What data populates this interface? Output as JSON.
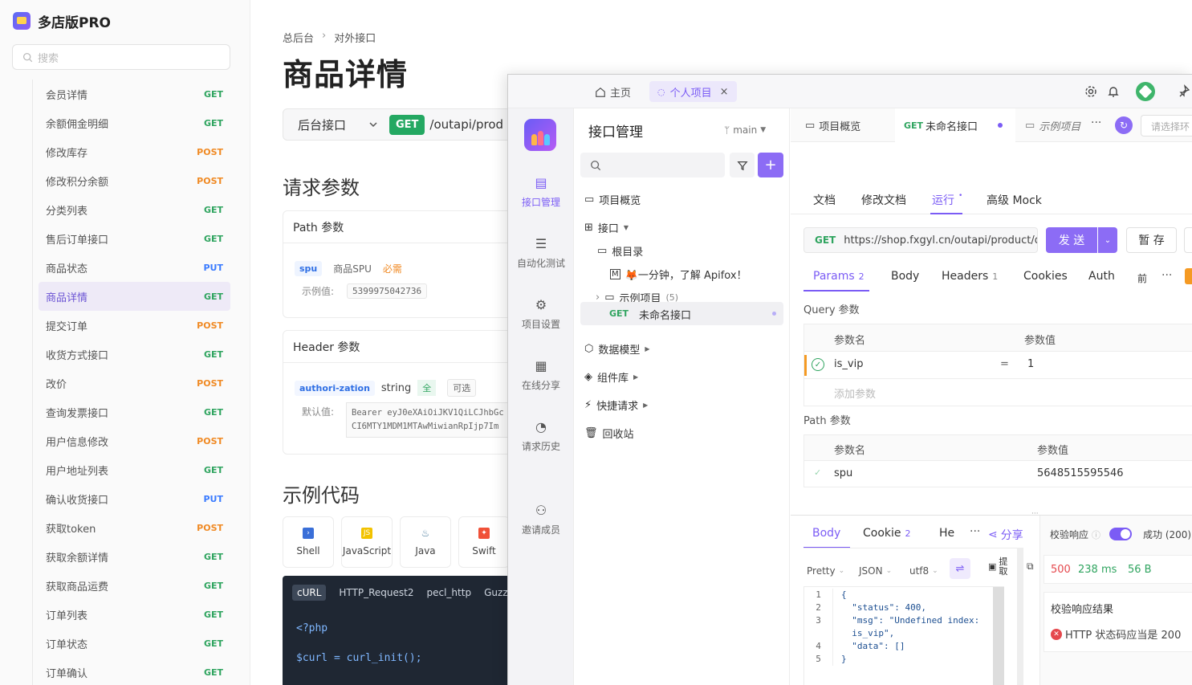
{
  "brand": {
    "name": "多店版PRO"
  },
  "doc_search": {
    "placeholder": "搜索"
  },
  "doc_list": [
    {
      "label": "会员详情",
      "method": "GET"
    },
    {
      "label": "余额佣金明细",
      "method": "GET"
    },
    {
      "label": "修改库存",
      "method": "POST"
    },
    {
      "label": "修改积分余额",
      "method": "POST"
    },
    {
      "label": "分类列表",
      "method": "GET"
    },
    {
      "label": "售后订单接口",
      "method": "GET"
    },
    {
      "label": "商品状态",
      "method": "PUT"
    },
    {
      "label": "商品详情",
      "method": "GET",
      "active": true
    },
    {
      "label": "提交订单",
      "method": "POST"
    },
    {
      "label": "收货方式接口",
      "method": "GET"
    },
    {
      "label": "改价",
      "method": "POST"
    },
    {
      "label": "查询发票接口",
      "method": "GET"
    },
    {
      "label": "用户信息修改",
      "method": "POST"
    },
    {
      "label": "用户地址列表",
      "method": "GET"
    },
    {
      "label": "确认收货接口",
      "method": "PUT"
    },
    {
      "label": "获取token",
      "method": "POST"
    },
    {
      "label": "获取余额详情",
      "method": "GET"
    },
    {
      "label": "获取商品运费",
      "method": "GET"
    },
    {
      "label": "订单列表",
      "method": "GET"
    },
    {
      "label": "订单状态",
      "method": "GET"
    },
    {
      "label": "订单确认",
      "method": "GET"
    }
  ],
  "doc": {
    "breadcrumb": [
      "总后台",
      "›",
      "对外接口"
    ],
    "title": "商品详情",
    "api_group": "后台接口",
    "method": "GET",
    "path": "/outapi/prod",
    "req_params_title": "请求参数",
    "path_params": {
      "title": "Path 参数",
      "name": "spu",
      "desc": "商品SPU",
      "required": "必需",
      "example_label": "示例值:",
      "example": "5399975042736"
    },
    "header_params": {
      "title": "Header 参数",
      "name": "authori-zation",
      "type": "string",
      "all": "全",
      "optional": "可选",
      "default_label": "默认值:",
      "default_line1": "Bearer eyJ0eXAiOiJKV1QiLCJhbGc",
      "default_line2": "CI6MTY1MDM1MTAwMiwianRpIjp7Im"
    },
    "example_title": "示例代码",
    "langs": [
      "Shell",
      "JavaScript",
      "Java",
      "Swift"
    ],
    "code_tabs": [
      "cURL",
      "HTTP_Request2",
      "pecl_http",
      "Guzzle"
    ],
    "code_lines": [
      "<?php",
      "$curl = curl_init();"
    ]
  },
  "app": {
    "tab_home": "主页",
    "tab_project": "个人项目",
    "tab_close": "×",
    "rail": [
      {
        "label": "接口管理",
        "active": true
      },
      {
        "label": "自动化测试"
      },
      {
        "label": "项目设置"
      },
      {
        "label": "在线分享"
      },
      {
        "label": "请求历史"
      },
      {
        "label": "邀请成员"
      }
    ],
    "tree": {
      "title": "接口管理",
      "branch": "main",
      "items": {
        "overview": "项目概览",
        "api": "接口",
        "root": "根目录",
        "intro": "🦊一分钟，了解 Apifox！",
        "examples": "示例项目",
        "examples_count": "(5)",
        "current_method": "GET",
        "current": "未命名接口",
        "models": "数据模型",
        "components": "组件库",
        "quick": "快捷请求",
        "trash": "回收站"
      }
    },
    "top_tabs": {
      "overview": "项目概览",
      "active_method": "GET",
      "active": "未命名接口",
      "examples": "示例项目",
      "more": "···",
      "env": "请选择环"
    },
    "sub_tabs": [
      "文档",
      "修改文档",
      "运行",
      "高级 Mock"
    ],
    "request": {
      "method": "GET",
      "url": "https://shop.fxgyl.cn/outapi/product/de",
      "send": "发 送",
      "save": "暂 存"
    },
    "param_tabs": {
      "params": "Params",
      "params_count": "2",
      "body": "Body",
      "headers": "Headers",
      "headers_count": "1",
      "cookies": "Cookies",
      "auth": "Auth",
      "pre": "前",
      "more": "···"
    },
    "query": {
      "title": "Query 参数",
      "col_name": "参数名",
      "col_value": "参数值",
      "row_name": "is_vip",
      "eq": "=",
      "row_value": "1",
      "add": "添加参数"
    },
    "path": {
      "title": "Path 参数",
      "col_name": "参数名",
      "col_value": "参数值",
      "row_name": "spu",
      "row_value": "5648515595546"
    },
    "resp_tabs": {
      "body": "Body",
      "cookie": "Cookie",
      "cookie_count": "2",
      "headers": "He",
      "more": "···",
      "share": "分享"
    },
    "resp_opts": {
      "pretty": "Pretty",
      "json": "JSON",
      "enc": "utf8",
      "extract": "提取"
    },
    "resp_lines": [
      {
        "n": "1",
        "t": "{"
      },
      {
        "n": "2",
        "t": "  \"status\": 400,"
      },
      {
        "n": "3",
        "t": "  \"msg\": \"Undefined index:"
      },
      {
        "n": "",
        "t": "  is_vip\","
      },
      {
        "n": "4",
        "t": "  \"data\": []"
      },
      {
        "n": "5",
        "t": "}"
      }
    ],
    "validate": {
      "label": "校验响应",
      "success": "成功 (200)",
      "status": "500",
      "time": "238 ms",
      "size": "56 B",
      "result_title": "校验响应结果",
      "error": "HTTP 状态码应当是 200"
    }
  },
  "colors": {
    "accent": "#7b5cf5",
    "get": "#2fa45f",
    "post": "#f08a24",
    "put": "#3a7bff"
  }
}
